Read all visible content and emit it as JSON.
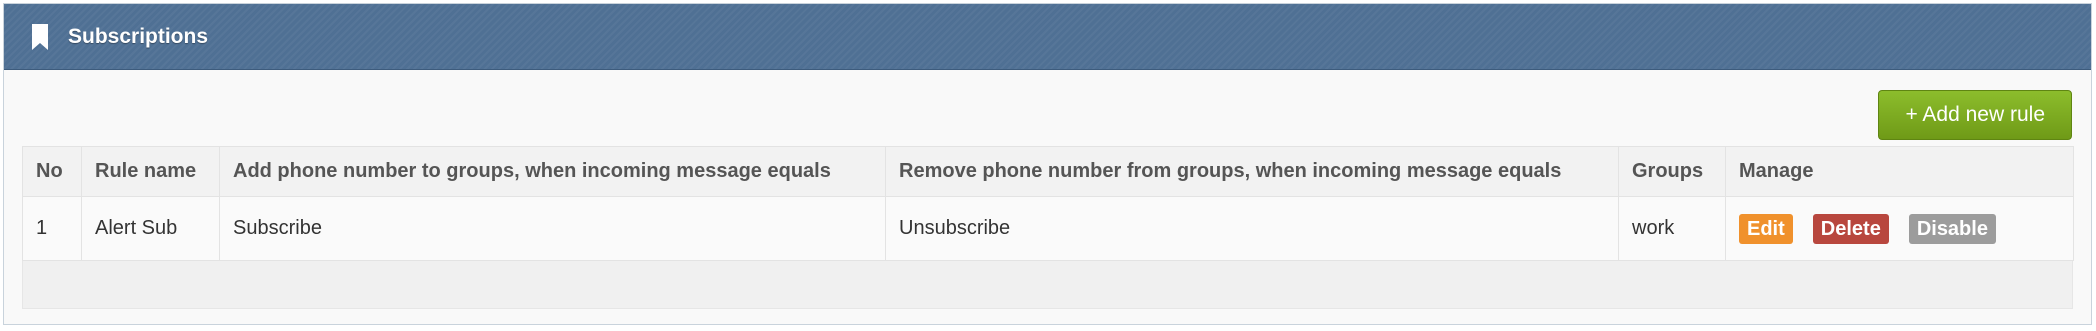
{
  "widget": {
    "title": "Subscriptions",
    "icon": "bookmark-icon"
  },
  "toolbar": {
    "add_label": "+ Add new rule"
  },
  "table": {
    "headers": [
      "No",
      "Rule name",
      "Add phone number to groups, when incoming message equals",
      "Remove phone number from groups, when incoming message equals",
      "Groups",
      "Manage"
    ],
    "rows": [
      {
        "no": "1",
        "rule_name": "Alert Sub",
        "add_message": "Subscribe",
        "remove_message": "Unsubscribe",
        "groups": "work",
        "actions": {
          "edit": "Edit",
          "delete": "Delete",
          "disable": "Disable"
        }
      }
    ]
  },
  "colors": {
    "header_bg": "#4f7094",
    "add_button": "#7fae22",
    "edit": "#f0912c",
    "delete": "#b8473e",
    "disable": "#9c9c9c"
  }
}
